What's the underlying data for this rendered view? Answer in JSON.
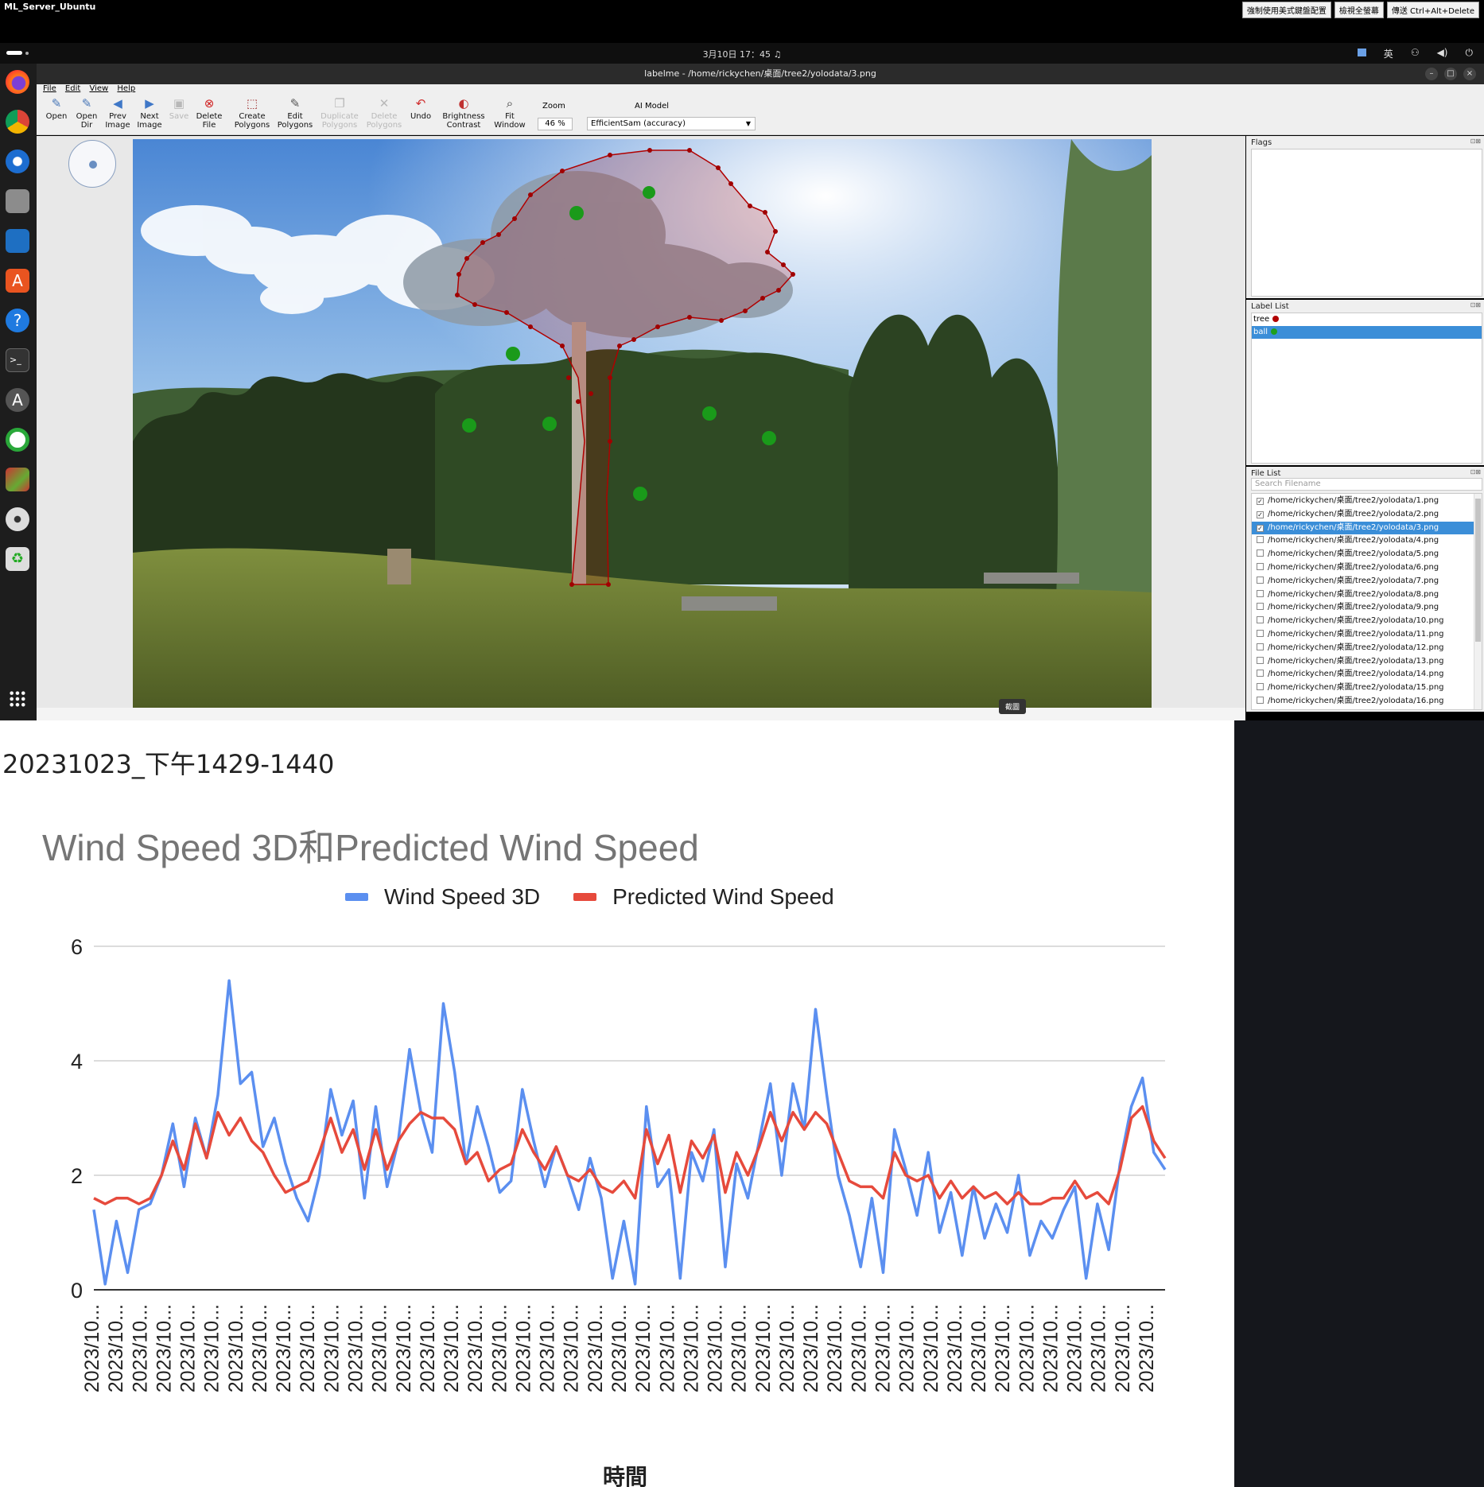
{
  "remote": {
    "title": "ML_Server_Ubuntu",
    "buttons": [
      "強制使用美式鍵盤配置",
      "檢視全螢幕",
      "傳送 Ctrl+Alt+Delete"
    ]
  },
  "panel": {
    "clock": "3月10日 17：45",
    "ime": "英"
  },
  "window": {
    "title": "labelme - /home/rickychen/桌面/tree2/yolodata/3.png"
  },
  "menu": [
    "File",
    "Edit",
    "View",
    "Help"
  ],
  "toolbar": {
    "open": "Open",
    "open_dir": [
      "Open",
      "Dir"
    ],
    "prev": [
      "Prev",
      "Image"
    ],
    "next": [
      "Next",
      "Image"
    ],
    "save": "Save",
    "delete_file": [
      "Delete",
      "File"
    ],
    "create_polygons": [
      "Create",
      "Polygons"
    ],
    "edit_polygons": [
      "Edit",
      "Polygons"
    ],
    "duplicate_polygons": [
      "Duplicate",
      "Polygons"
    ],
    "delete_polygons": [
      "Delete",
      "Polygons"
    ],
    "undo": "Undo",
    "brightness": [
      "Brightness",
      "Contrast"
    ],
    "fit_window": [
      "Fit",
      "Window"
    ],
    "zoom_label": "Zoom",
    "zoom_value": "46 %",
    "ai_label": "AI Model",
    "ai_value": "EfficientSam (accuracy)"
  },
  "tooltip": "截圖",
  "flags": {
    "title": "Flags"
  },
  "label_list": {
    "title": "Label List",
    "items": [
      {
        "label": "tree",
        "color": "#b10000",
        "selected": false
      },
      {
        "label": "ball",
        "color": "#1ea01e",
        "selected": true
      }
    ]
  },
  "file_list": {
    "title": "File List",
    "search_placeholder": "Search Filename",
    "items": [
      {
        "path": "/home/rickychen/桌面/tree2/yolodata/1.png",
        "checked": true,
        "selected": false
      },
      {
        "path": "/home/rickychen/桌面/tree2/yolodata/2.png",
        "checked": true,
        "selected": false
      },
      {
        "path": "/home/rickychen/桌面/tree2/yolodata/3.png",
        "checked": true,
        "selected": true
      },
      {
        "path": "/home/rickychen/桌面/tree2/yolodata/4.png",
        "checked": false,
        "selected": false
      },
      {
        "path": "/home/rickychen/桌面/tree2/yolodata/5.png",
        "checked": false,
        "selected": false
      },
      {
        "path": "/home/rickychen/桌面/tree2/yolodata/6.png",
        "checked": false,
        "selected": false
      },
      {
        "path": "/home/rickychen/桌面/tree2/yolodata/7.png",
        "checked": false,
        "selected": false
      },
      {
        "path": "/home/rickychen/桌面/tree2/yolodata/8.png",
        "checked": false,
        "selected": false
      },
      {
        "path": "/home/rickychen/桌面/tree2/yolodata/9.png",
        "checked": false,
        "selected": false
      },
      {
        "path": "/home/rickychen/桌面/tree2/yolodata/10.png",
        "checked": false,
        "selected": false
      },
      {
        "path": "/home/rickychen/桌面/tree2/yolodata/11.png",
        "checked": false,
        "selected": false
      },
      {
        "path": "/home/rickychen/桌面/tree2/yolodata/12.png",
        "checked": false,
        "selected": false
      },
      {
        "path": "/home/rickychen/桌面/tree2/yolodata/13.png",
        "checked": false,
        "selected": false
      },
      {
        "path": "/home/rickychen/桌面/tree2/yolodata/14.png",
        "checked": false,
        "selected": false
      },
      {
        "path": "/home/rickychen/桌面/tree2/yolodata/15.png",
        "checked": false,
        "selected": false
      },
      {
        "path": "/home/rickychen/桌面/tree2/yolodata/16.png",
        "checked": false,
        "selected": false
      }
    ]
  },
  "slide": {
    "caption": "20231023_下午1429-1440"
  },
  "chart_data": {
    "type": "line",
    "title": "Wind Speed 3D和Predicted Wind Speed",
    "xlabel": "時間",
    "ylabel": "",
    "ylim": [
      0,
      6
    ],
    "yticks": [
      0,
      2,
      4,
      6
    ],
    "grid": true,
    "legend_position": "top",
    "x_tick_label": "2023/10...",
    "x_tick_count": 45,
    "series": [
      {
        "name": "Wind Speed 3D",
        "color": "#5b8ff0",
        "values": [
          1.4,
          0.1,
          1.2,
          0.3,
          1.4,
          1.5,
          2.0,
          2.9,
          1.8,
          3.0,
          2.3,
          3.4,
          5.4,
          3.6,
          3.8,
          2.5,
          3.0,
          2.2,
          1.6,
          1.2,
          2.0,
          3.5,
          2.7,
          3.3,
          1.6,
          3.2,
          1.8,
          2.6,
          4.2,
          3.1,
          2.4,
          5.0,
          3.8,
          2.2,
          3.2,
          2.5,
          1.7,
          1.9,
          3.5,
          2.6,
          1.8,
          2.5,
          2.0,
          1.4,
          2.3,
          1.6,
          0.2,
          1.2,
          0.1,
          3.2,
          1.8,
          2.1,
          0.2,
          2.4,
          1.9,
          2.8,
          0.4,
          2.2,
          1.6,
          2.6,
          3.6,
          2.0,
          3.6,
          2.8,
          4.9,
          3.4,
          2.0,
          1.3,
          0.4,
          1.6,
          0.3,
          2.8,
          2.1,
          1.3,
          2.4,
          1.0,
          1.7,
          0.6,
          1.8,
          0.9,
          1.5,
          1.0,
          2.0,
          0.6,
          1.2,
          0.9,
          1.4,
          1.8,
          0.2,
          1.5,
          0.7,
          2.2,
          3.2,
          3.7,
          2.4,
          2.1
        ]
      },
      {
        "name": "Predicted Wind Speed",
        "color": "#e64a3c",
        "values": [
          1.6,
          1.5,
          1.6,
          1.6,
          1.5,
          1.6,
          2.0,
          2.6,
          2.1,
          2.9,
          2.3,
          3.1,
          2.7,
          3.0,
          2.6,
          2.4,
          2.0,
          1.7,
          1.8,
          1.9,
          2.4,
          3.0,
          2.4,
          2.8,
          2.1,
          2.8,
          2.1,
          2.6,
          2.9,
          3.1,
          3.0,
          3.0,
          2.8,
          2.2,
          2.4,
          1.9,
          2.1,
          2.2,
          2.8,
          2.4,
          2.1,
          2.5,
          2.0,
          1.9,
          2.1,
          1.8,
          1.7,
          1.9,
          1.6,
          2.8,
          2.2,
          2.7,
          1.7,
          2.6,
          2.3,
          2.7,
          1.7,
          2.4,
          2.0,
          2.5,
          3.1,
          2.6,
          3.1,
          2.8,
          3.1,
          2.9,
          2.4,
          1.9,
          1.8,
          1.8,
          1.6,
          2.4,
          2.0,
          1.9,
          2.0,
          1.6,
          1.9,
          1.6,
          1.8,
          1.6,
          1.7,
          1.5,
          1.7,
          1.5,
          1.5,
          1.6,
          1.6,
          1.9,
          1.6,
          1.7,
          1.5,
          2.1,
          3.0,
          3.2,
          2.6,
          2.3
        ]
      }
    ]
  }
}
